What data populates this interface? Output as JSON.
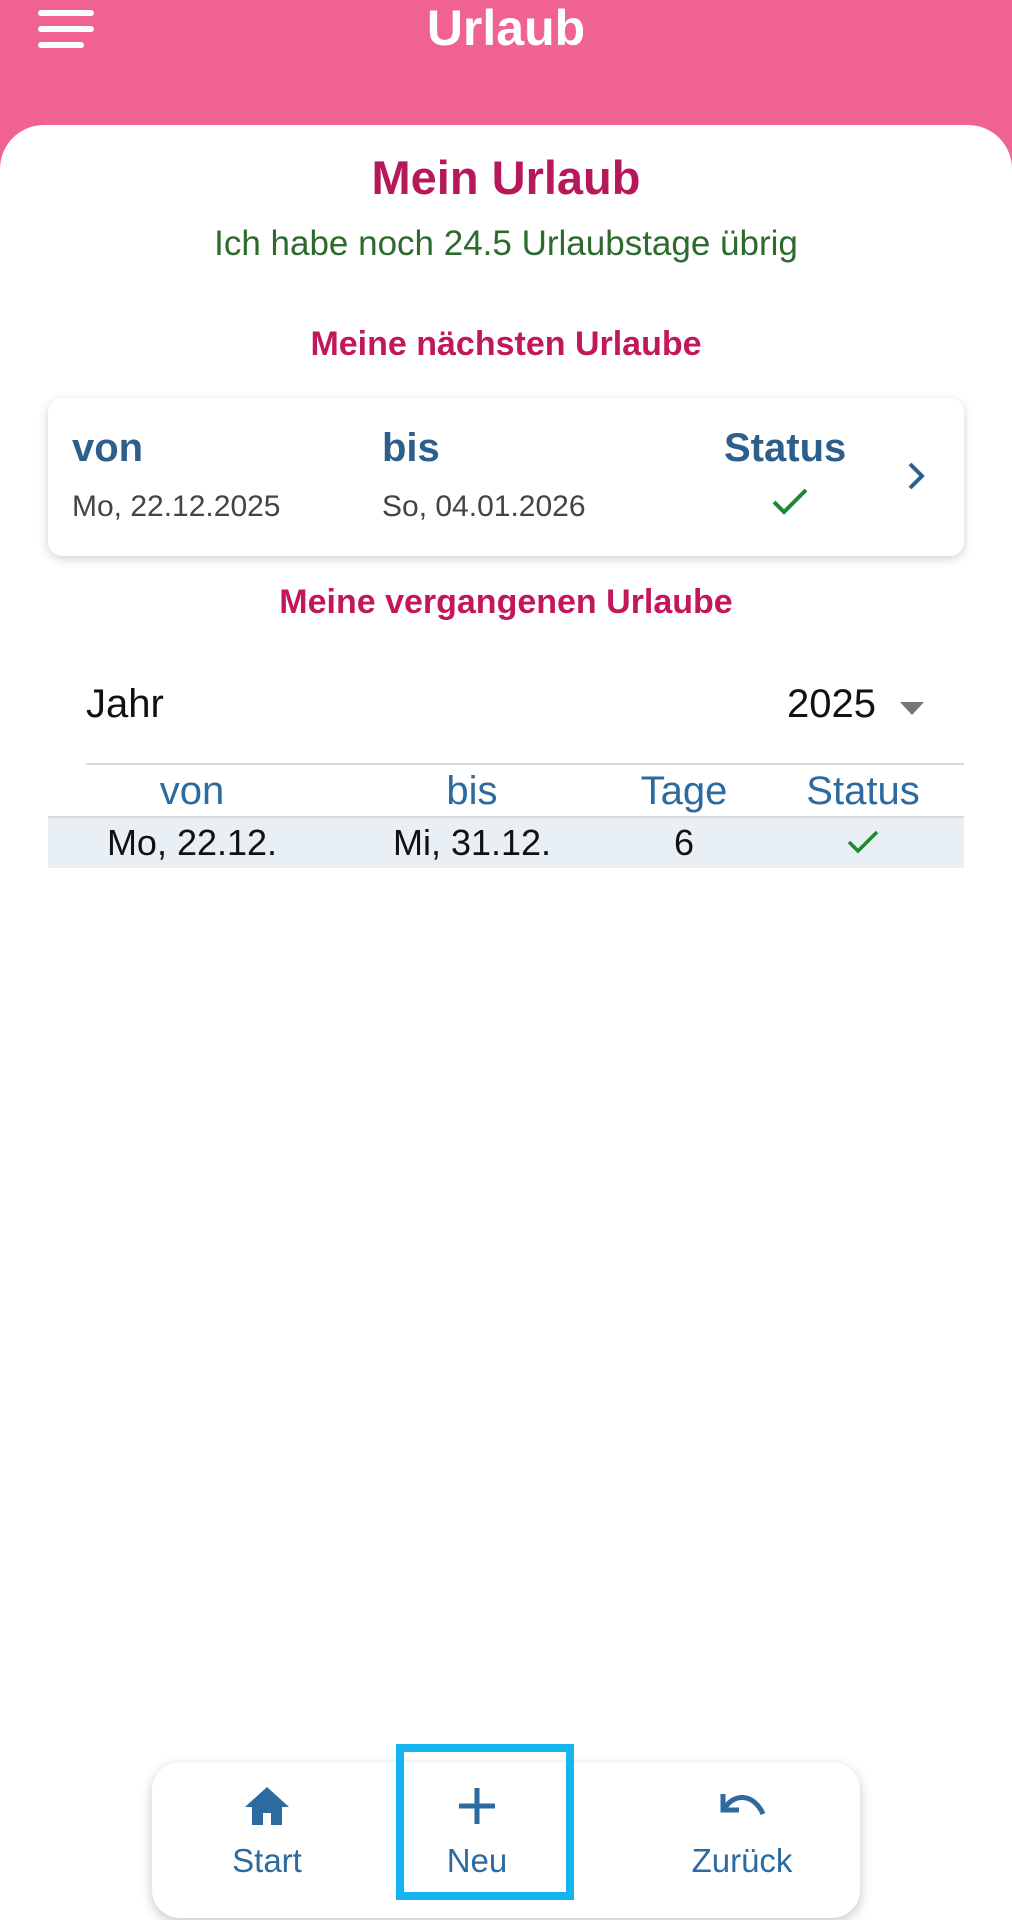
{
  "appbar": {
    "title": "Urlaub",
    "menu_icon": "menu-icon"
  },
  "main": {
    "title": "Mein Urlaub",
    "remaining_text": "Ich habe noch 24.5 Urlaubstage übrig"
  },
  "next_vacations": {
    "heading": "Meine nächsten Urlaube",
    "columns": {
      "from": "von",
      "to": "bis",
      "status": "Status"
    },
    "items": [
      {
        "from": "Mo, 22.12.2025",
        "to": "So, 04.01.2026",
        "status_icon": "check-icon"
      }
    ]
  },
  "past_vacations": {
    "heading": "Meine vergangenen Urlaube",
    "year_label": "Jahr",
    "year_value": "2025",
    "columns": {
      "from": "von",
      "to": "bis",
      "days": "Tage",
      "status": "Status"
    },
    "rows": [
      {
        "from": "Mo, 22.12.",
        "to": "Mi, 31.12.",
        "days": "6",
        "status_icon": "check-icon"
      }
    ]
  },
  "bottom_nav": {
    "start_label": "Start",
    "new_label": "Neu",
    "back_label": "Zurück"
  },
  "colors": {
    "appbar": "#f06391",
    "title_magenta": "#b5195a",
    "remaining_green": "#2d6a2d",
    "header_blue": "#2c5f8c",
    "check_green": "#1e8a2e",
    "highlight_blue": "#14b4ee"
  }
}
